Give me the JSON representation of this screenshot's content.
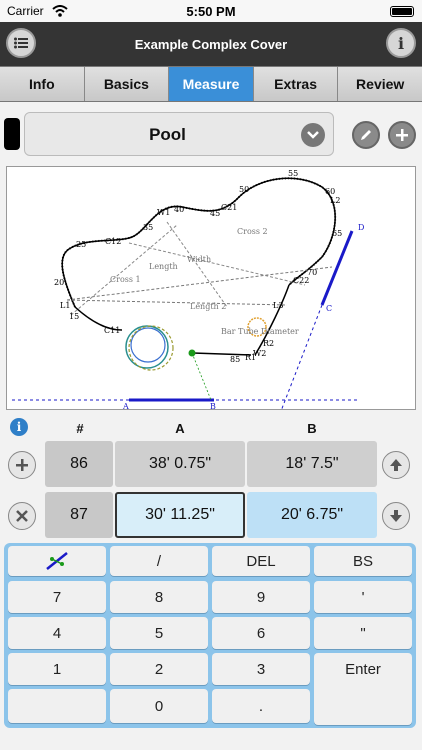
{
  "status": {
    "carrier": "Carrier",
    "time": "5:50 PM"
  },
  "header": {
    "title": "Example Complex Cover",
    "menu_icon": "list-icon",
    "info_icon": "info-icon"
  },
  "tabs": [
    {
      "label": "Info",
      "active": false
    },
    {
      "label": "Basics",
      "active": false
    },
    {
      "label": "Measure",
      "active": true
    },
    {
      "label": "Extras",
      "active": false
    },
    {
      "label": "Review",
      "active": false
    }
  ],
  "selector": {
    "value": "Pool"
  },
  "diagram": {
    "labels": {
      "n55": "55",
      "n60": "60",
      "L2": "L2",
      "n50": "50",
      "C21": "C21",
      "n45": "45",
      "n40": "40",
      "W1": "W1",
      "n35": "35",
      "C12": "C12",
      "n25": "25",
      "n20": "20",
      "L1": "L1",
      "n15": "15",
      "C11": "C11",
      "n65": "65",
      "n70": "70",
      "C22": "C22",
      "L3": "L3",
      "R2": "R2",
      "W2": "W2",
      "R1": "R1",
      "n85": "85",
      "D": "D",
      "C": "C",
      "A": "A",
      "B": "B",
      "cross2": "Cross 2",
      "cross1": "Cross 1",
      "length": "Length",
      "width": "Width",
      "length2": "Length 2",
      "bartube": "Bar Tube Diameter"
    }
  },
  "table": {
    "headers": {
      "num": "#",
      "a": "A",
      "b": "B"
    },
    "rows": [
      {
        "num": "86",
        "a": "38' 0.75\"",
        "b": "18' 7.5\""
      },
      {
        "num": "87",
        "a": "30' 11.25\"",
        "b": "20' 6.75\""
      }
    ]
  },
  "keypad": {
    "row1": [
      "/",
      "DEL",
      "BS"
    ],
    "row2": [
      "7",
      "8",
      "9",
      "'"
    ],
    "row3": [
      "4",
      "5",
      "6",
      "\""
    ],
    "row4": [
      "1",
      "2",
      "3"
    ],
    "row5": [
      "0",
      "."
    ],
    "enter": "Enter"
  },
  "colors": {
    "accent": "#3a8fd8",
    "titlebar": "#343434",
    "keypad": "#8cc4ea"
  }
}
